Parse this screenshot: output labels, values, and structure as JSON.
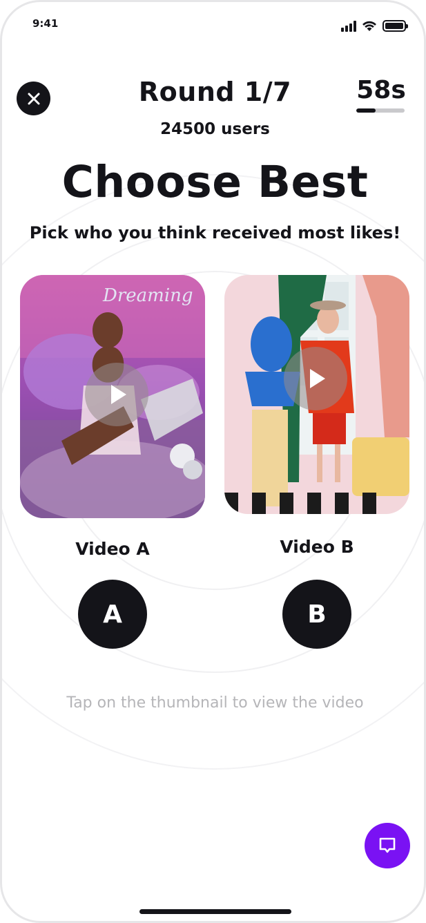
{
  "status_bar": {
    "time": "9:41",
    "icons": [
      "signal-icon",
      "wifi-icon",
      "battery-icon"
    ]
  },
  "header": {
    "close_icon": "close-icon",
    "round_label": "Round 1/7",
    "users_label": "24500 users",
    "timer_label": "58s",
    "timer_progress": 0.4
  },
  "main": {
    "title": "Choose Best",
    "subtitle": "Pick who you think received most likes!",
    "videos": [
      {
        "label": "Video A",
        "choice": "A",
        "thumbnail": "woman-neon-room-thumbnail",
        "play_icon": "play-icon"
      },
      {
        "label": "Video B",
        "choice": "B",
        "thumbnail": "man-statue-room-thumbnail",
        "play_icon": "play-icon"
      }
    ],
    "hint": "Tap on the thumbnail to view the video"
  },
  "chat": {
    "icon": "chat-icon",
    "color": "#7a12f3"
  },
  "colors": {
    "primary": "#141419",
    "accent": "#7a12f3",
    "muted": "#b5b5b8"
  }
}
